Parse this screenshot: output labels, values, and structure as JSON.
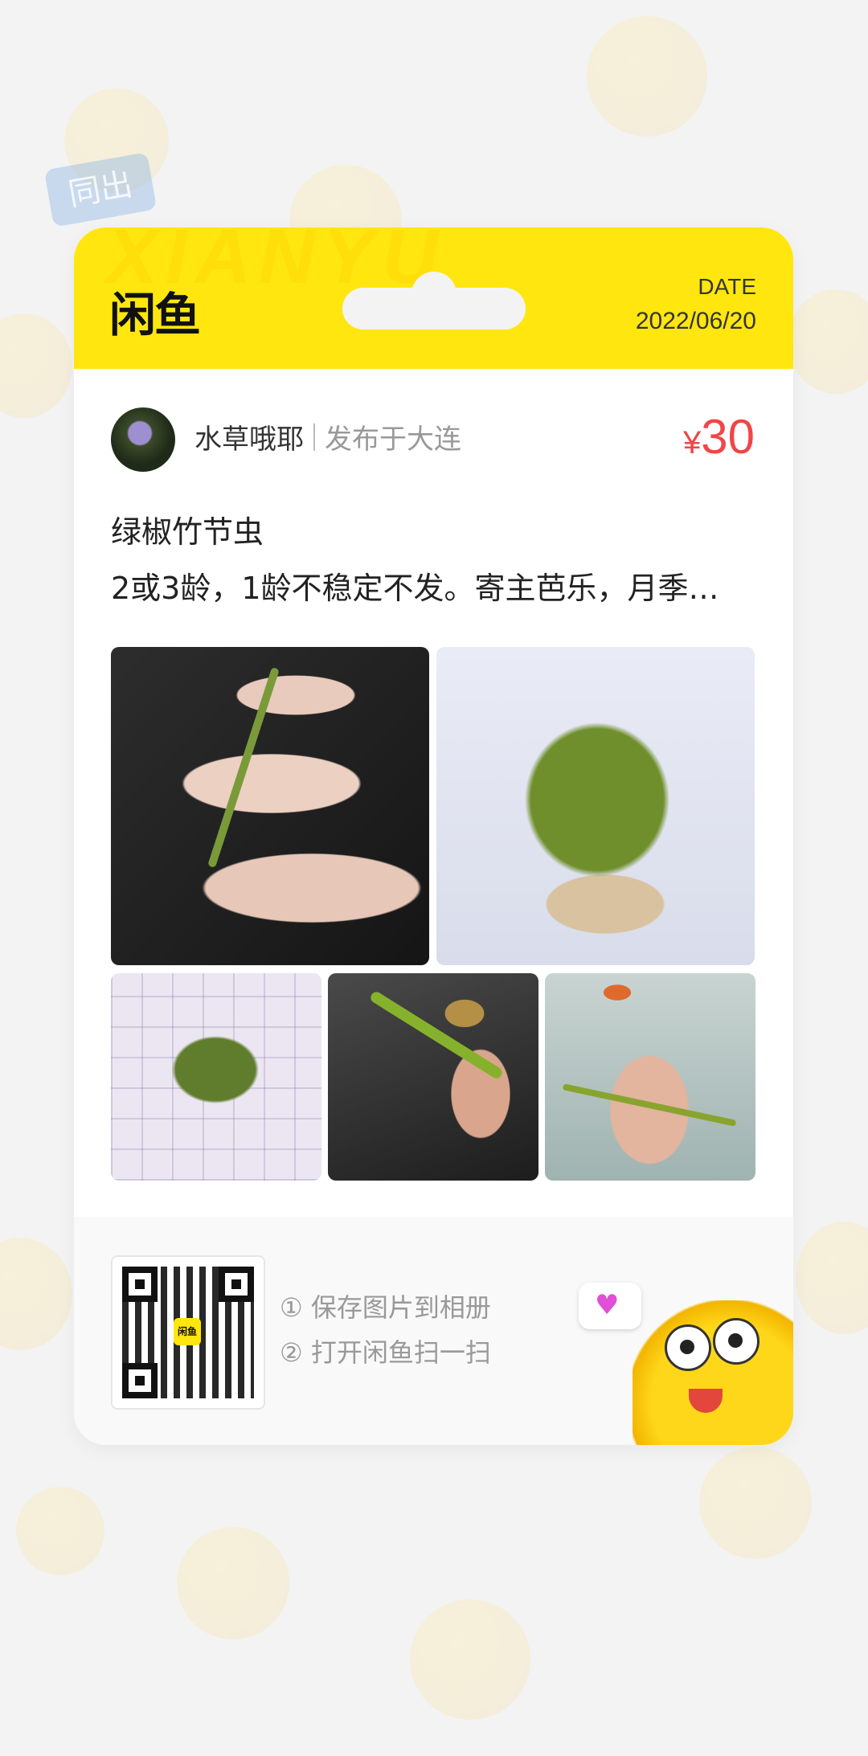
{
  "header": {
    "logo_text": "闲鱼",
    "watermark": "XIANYU",
    "date_label": "DATE",
    "date_value": "2022/06/20"
  },
  "post": {
    "username": "水草哦耶",
    "location": "发布于大连",
    "price_symbol": "¥",
    "price": "30",
    "title": "绿椒竹节虫",
    "description": "2或3龄，1龄不稳定不发。寄主芭乐，月季…"
  },
  "background": {
    "tag_text": "同出"
  },
  "footer": {
    "qr_logo": "闲鱼",
    "step1": "① 保存图片到相册",
    "step2": "② 打开闲鱼扫一扫"
  },
  "colors": {
    "brand_yellow": "#ffe60f",
    "price_red": "#f04646"
  },
  "icons": {
    "heart": "heart-icon",
    "mascot": "fish-mascot"
  }
}
